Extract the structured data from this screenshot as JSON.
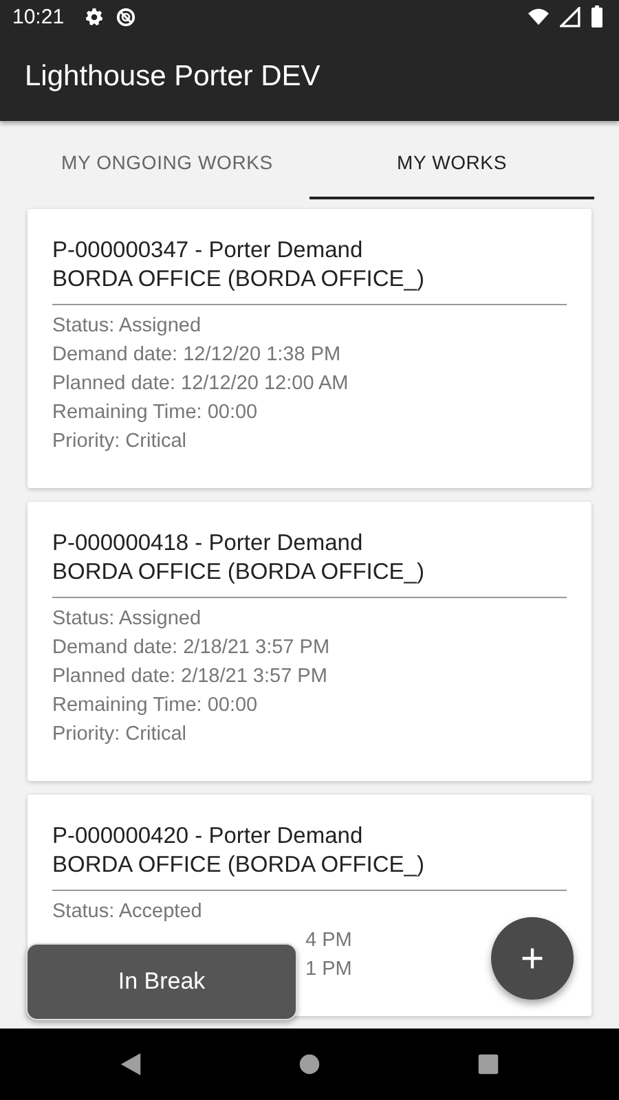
{
  "status_bar": {
    "time": "10:21"
  },
  "app_bar": {
    "title": "Lighthouse Porter DEV"
  },
  "tabs": [
    {
      "label": "MY ONGOING WORKS",
      "selected": false
    },
    {
      "label": "MY WORKS",
      "selected": true
    }
  ],
  "works": [
    {
      "title": "P-000000347 - Porter Demand",
      "location": "BORDA OFFICE (BORDA OFFICE_)",
      "details": [
        {
          "kind": "line",
          "text": "Status: Assigned"
        },
        {
          "kind": "line",
          "text": "Demand date: 12/12/20 1:38 PM"
        },
        {
          "kind": "line",
          "text": "Planned date: 12/12/20 12:00 AM"
        },
        {
          "kind": "line",
          "text": "Remaining Time: 00:00"
        },
        {
          "kind": "line",
          "text": "Priority: Critical"
        }
      ]
    },
    {
      "title": "P-000000418 - Porter Demand",
      "location": "BORDA OFFICE (BORDA OFFICE_)",
      "details": [
        {
          "kind": "line",
          "text": "Status: Assigned"
        },
        {
          "kind": "line",
          "text": "Demand date: 2/18/21 3:57 PM"
        },
        {
          "kind": "line",
          "text": "Planned date: 2/18/21 3:57 PM"
        },
        {
          "kind": "line",
          "text": "Remaining Time: 00:00"
        },
        {
          "kind": "line",
          "text": "Priority: Critical"
        }
      ]
    },
    {
      "title": "P-000000420 - Porter Demand",
      "location": "BORDA OFFICE (BORDA OFFICE_)",
      "details": [
        {
          "kind": "line",
          "text": "Status: Accepted"
        },
        {
          "kind": "tail",
          "text": "4 PM"
        },
        {
          "kind": "tail",
          "text": "1 PM"
        }
      ]
    }
  ],
  "break_button": {
    "label": "In Break"
  }
}
